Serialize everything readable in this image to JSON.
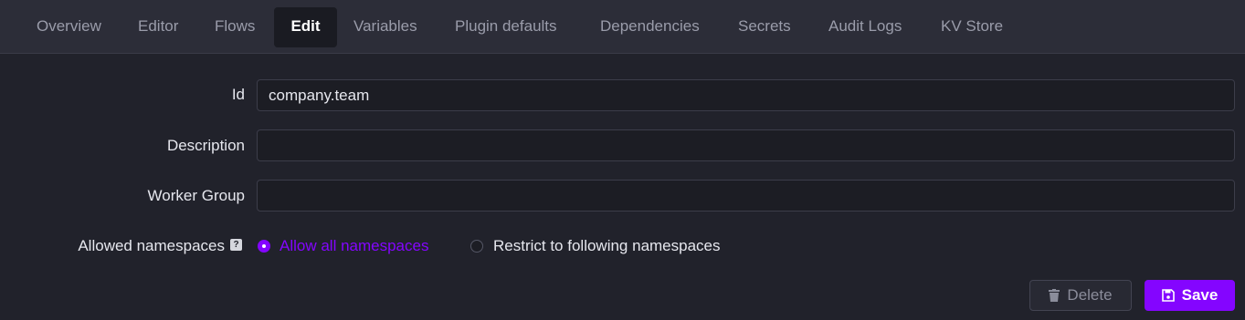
{
  "tabs": [
    {
      "label": "Overview"
    },
    {
      "label": "Editor"
    },
    {
      "label": "Flows"
    },
    {
      "label": "Edit"
    },
    {
      "label": "Variables"
    },
    {
      "label": "Plugin defaults"
    },
    {
      "label": "Dependencies"
    },
    {
      "label": "Secrets"
    },
    {
      "label": "Audit Logs"
    },
    {
      "label": "KV Store"
    }
  ],
  "active_tab": "Edit",
  "form": {
    "id_label": "Id",
    "id_value": "company.team",
    "description_label": "Description",
    "description_value": "",
    "worker_group_label": "Worker Group",
    "worker_group_value": "",
    "allowed_namespaces_label": "Allowed namespaces",
    "help_icon": "?",
    "option_allow_all": "Allow all namespaces",
    "option_restrict": "Restrict to following namespaces",
    "selected_option": "Allow all namespaces"
  },
  "actions": {
    "delete_label": "Delete",
    "save_label": "Save"
  },
  "colors": {
    "accent": "#8405ff",
    "background": "#21222b",
    "tabbar": "#2c2d38"
  }
}
